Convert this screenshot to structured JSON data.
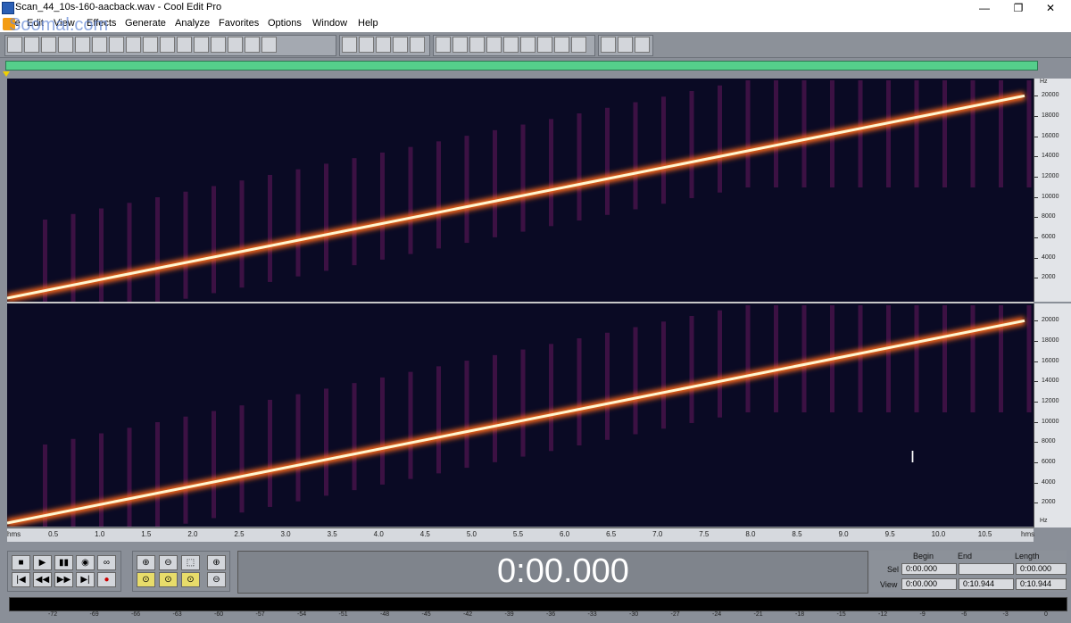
{
  "window": {
    "title": "Scan_44_10s-160-aacback.wav - Cool Edit Pro",
    "minimize": "—",
    "maximize": "❐",
    "close": "✕"
  },
  "watermark": "Soomal.com",
  "menu": [
    "File",
    "Edit",
    "View",
    "Effects",
    "Generate",
    "Analyze",
    "Favorites",
    "Options",
    "Window",
    "Help"
  ],
  "toolbar": {
    "groups": [
      [
        "wave-view",
        "new",
        "open",
        "save",
        "save-as",
        "close-file",
        "undo",
        "redo",
        "repeat",
        "mix",
        "copy",
        "cut",
        "paste",
        "paste-mix",
        "cue",
        "mono"
      ],
      [
        "spectral-view",
        "frequency",
        "multitrack-a",
        "multitrack-b",
        "multitrack-c"
      ],
      [
        "view-1",
        "view-2",
        "view-3",
        "play",
        "zoom",
        "time",
        "bars",
        "meter",
        "window"
      ],
      [
        "settings",
        "script",
        "help"
      ]
    ]
  },
  "spectrogram": {
    "hz_unit": "Hz",
    "hz_ticks": [
      "20000",
      "18000",
      "16000",
      "14000",
      "12000",
      "10000",
      "8000",
      "6000",
      "4000",
      "2000"
    ],
    "channels": 2,
    "sweep_end_hz": 20000,
    "sweep_start_hz": 0
  },
  "timeline": {
    "start_label": "hms",
    "end_label": "hms",
    "ticks": [
      "0.5",
      "1.0",
      "1.5",
      "2.0",
      "2.5",
      "3.0",
      "3.5",
      "4.0",
      "4.5",
      "5.0",
      "5.5",
      "6.0",
      "6.5",
      "7.0",
      "7.5",
      "8.0",
      "8.5",
      "9.0",
      "9.5",
      "10.0",
      "10.5"
    ]
  },
  "transport": {
    "row1": [
      "■",
      "▶",
      "▮▮",
      "◉",
      "∞"
    ],
    "row2": [
      "|◀",
      "◀◀",
      "▶▶",
      "▶|",
      "●"
    ]
  },
  "zoom_controls": {
    "row1": [
      "⊕",
      "⊖",
      "⬚",
      "⊕"
    ],
    "row2": [
      "⊙",
      "⊙",
      "⊙",
      "⊖"
    ]
  },
  "time_display": "0:00.000",
  "selection": {
    "begin_label": "Begin",
    "end_label": "End",
    "length_label": "Length",
    "sel_label": "Sel",
    "view_label": "View",
    "sel_begin": "0:00.000",
    "sel_end": "",
    "sel_length": "0:00.000",
    "view_begin": "0:00.000",
    "view_end": "0:10.944",
    "view_length": "0:10.944"
  },
  "level_meter": {
    "db_labels": [
      "-72",
      "-69",
      "-66",
      "-63",
      "-60",
      "-57",
      "-54",
      "-51",
      "-48",
      "-45",
      "-42",
      "-39",
      "-36",
      "-33",
      "-30",
      "-27",
      "-24",
      "-21",
      "-18",
      "-15",
      "-12",
      "-9",
      "-6",
      "-3",
      "0"
    ]
  },
  "colors": {
    "spectrogram_bg": "#0a0a24",
    "sweep_core": "#fff6d0",
    "sweep_glow": "#ff6a1a",
    "artifact": "#7a1a6a",
    "progress": "#55cf8b"
  }
}
